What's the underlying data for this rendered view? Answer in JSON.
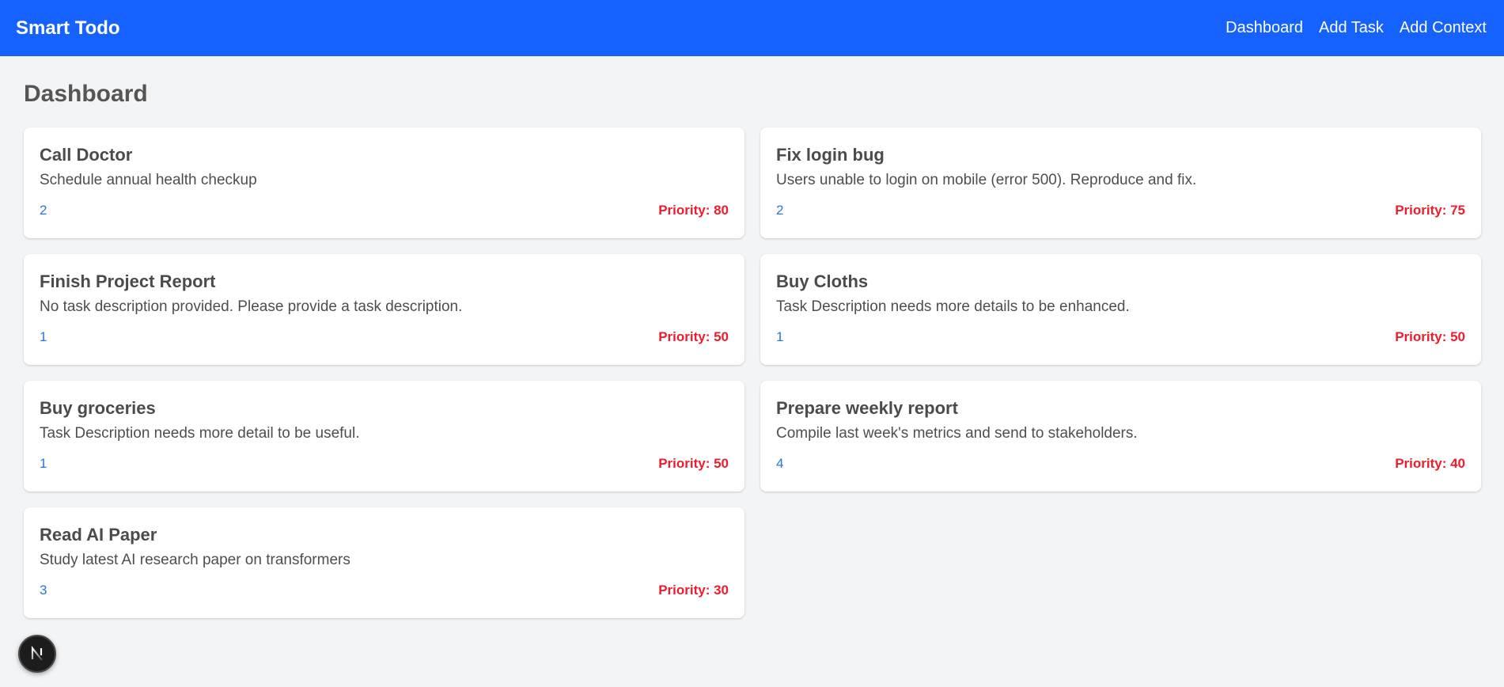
{
  "navbar": {
    "brand": "Smart Todo",
    "links": [
      "Dashboard",
      "Add Task",
      "Add Context"
    ]
  },
  "page": {
    "title": "Dashboard"
  },
  "tasks": [
    {
      "title": "Call Doctor",
      "description": "Schedule annual health checkup",
      "context": "2",
      "priority": "Priority: 80"
    },
    {
      "title": "Fix login bug",
      "description": "Users unable to login on mobile (error 500). Reproduce and fix.",
      "context": "2",
      "priority": "Priority: 75"
    },
    {
      "title": "Finish Project Report",
      "description": "No task description provided. Please provide a task description.",
      "context": "1",
      "priority": "Priority: 50"
    },
    {
      "title": "Buy Cloths",
      "description": "Task Description needs more details to be enhanced.",
      "context": "1",
      "priority": "Priority: 50"
    },
    {
      "title": "Buy groceries",
      "description": "Task Description needs more detail to be useful.",
      "context": "1",
      "priority": "Priority: 50"
    },
    {
      "title": "Prepare weekly report",
      "description": "Compile last week's metrics and send to stakeholders.",
      "context": "4",
      "priority": "Priority: 40"
    },
    {
      "title": "Read AI Paper",
      "description": "Study latest AI research paper on transformers",
      "context": "3",
      "priority": "Priority: 30"
    }
  ],
  "colors": {
    "navbar": "#1662ff",
    "background": "#f3f4f6",
    "priority": "#ef1c2c",
    "context": "#2b74e2"
  },
  "floating_badge": {
    "icon": "nextjs-logo-icon"
  }
}
